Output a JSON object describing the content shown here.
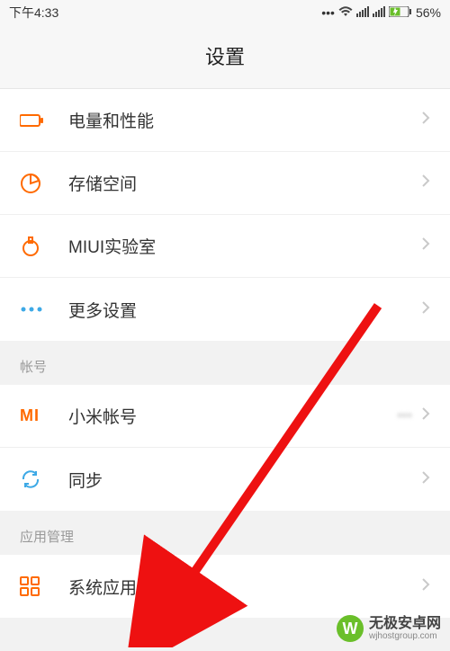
{
  "status": {
    "time": "下午4:33",
    "battery_pct": "56%"
  },
  "header": {
    "title": "设置"
  },
  "groups": [
    {
      "header": null,
      "items": [
        {
          "icon": "battery-icon",
          "label": "电量和性能",
          "value": null
        },
        {
          "icon": "storage-icon",
          "label": "存储空间",
          "value": null
        },
        {
          "icon": "lab-icon",
          "label": "MIUI实验室",
          "value": null
        },
        {
          "icon": "more-icon",
          "label": "更多设置",
          "value": null
        }
      ]
    },
    {
      "header": "帐号",
      "items": [
        {
          "icon": "mi-icon",
          "label": "小米帐号",
          "value": "•••"
        },
        {
          "icon": "sync-icon",
          "label": "同步",
          "value": null
        }
      ]
    },
    {
      "header": "应用管理",
      "items": [
        {
          "icon": "apps-icon",
          "label": "系统应用",
          "value": null
        }
      ]
    }
  ],
  "watermark": {
    "logo_glyph": "W",
    "main": "无极安卓网",
    "sub": "wjhostgroup.com"
  },
  "colors": {
    "accent_orange": "#ff6a00",
    "accent_blue": "#3da9e6",
    "accent_red": "#e11"
  }
}
